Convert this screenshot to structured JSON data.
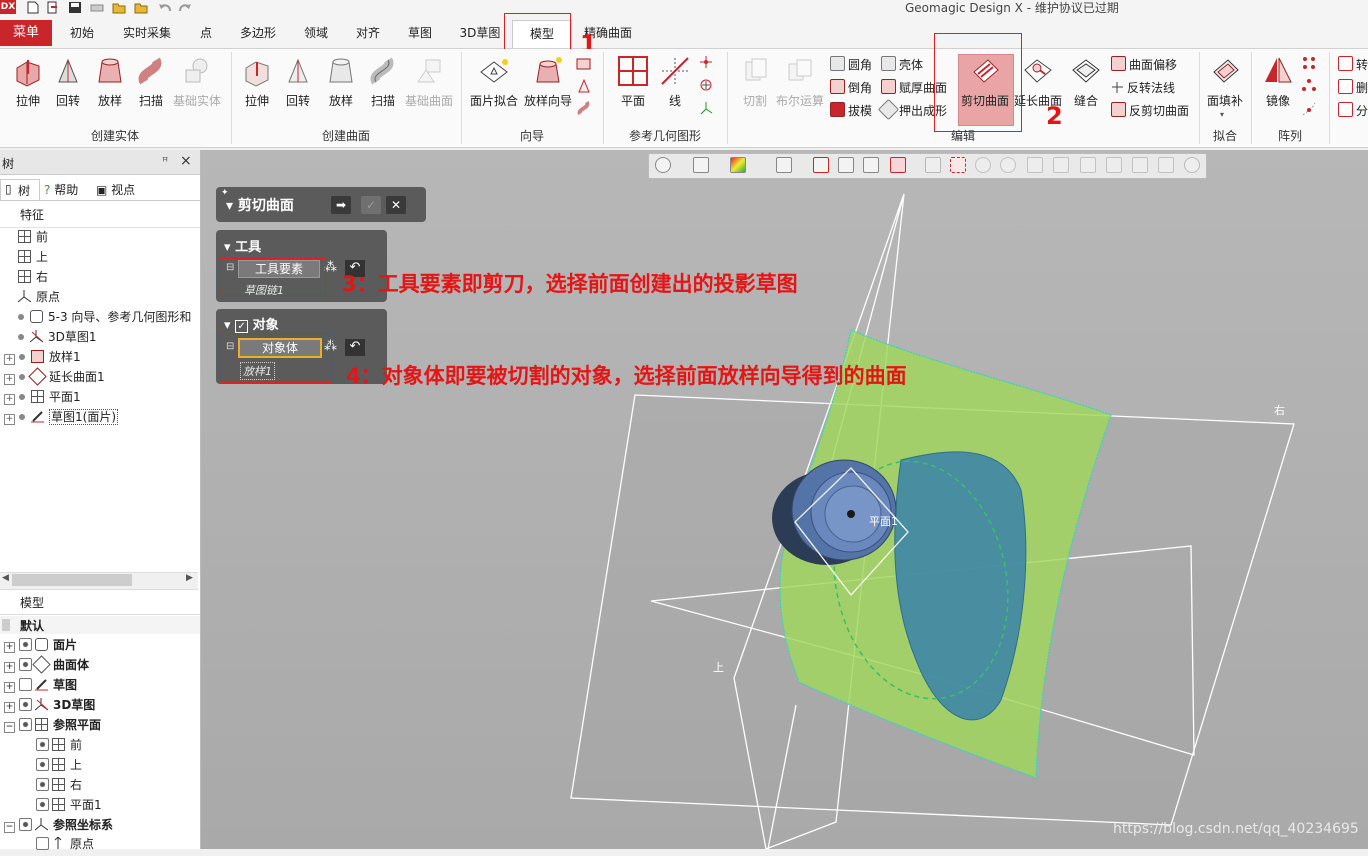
{
  "title_bar": {
    "logo": "DX",
    "window_title": "Geomagic Design X - 维护协议已过期"
  },
  "tabs": {
    "menu": "菜单",
    "items": [
      "初始",
      "实时采集",
      "点",
      "多边形",
      "领域",
      "对齐",
      "草图",
      "3D草图",
      "模型",
      "精确曲面"
    ],
    "active": "模型"
  },
  "ribbon": {
    "create_solid": {
      "label": "创建实体",
      "tools": [
        "拉伸",
        "回转",
        "放样",
        "扫描",
        "基础实体"
      ]
    },
    "create_surface": {
      "label": "创建曲面",
      "tools": [
        "拉伸",
        "回转",
        "放样",
        "扫描",
        "基础曲面"
      ]
    },
    "wizard": {
      "label": "向导",
      "tools": [
        "面片拟合",
        "放样向导"
      ]
    },
    "ref_geometry": {
      "label": "参考几何图形",
      "tools": [
        "平面",
        "线"
      ]
    },
    "edit": {
      "label": "编辑",
      "tools_disabled": [
        "切割",
        "布尔运算"
      ],
      "small_col1": [
        "圆角",
        "倒角",
        "拔模"
      ],
      "small_col2": [
        "壳体",
        "赋厚曲面",
        "押出成形"
      ],
      "trim_surface": "剪切曲面",
      "extend_surface": "延长曲面",
      "stitch": "缝合",
      "small_col3": [
        "曲面偏移",
        "反转法线",
        "反剪切曲面"
      ]
    },
    "fit": {
      "label": "拟合",
      "tools": [
        "面填补"
      ]
    },
    "array": {
      "label": "阵列",
      "tools": [
        "镜像"
      ]
    },
    "right_partial": [
      "转",
      "删",
      "分"
    ]
  },
  "tree_panel": {
    "title": "树",
    "pin": "ꟸ",
    "close": "×",
    "tabs": [
      "树",
      "帮助",
      "视点"
    ],
    "feature_header": "特征",
    "features": [
      "前",
      "上",
      "右",
      "原点",
      "5-3 向导、参考几何图形和",
      "3D草图1",
      "放样1",
      "延长曲面1",
      "平面1",
      "草图1(面片)"
    ],
    "model_header": "模型",
    "default_label": "默认",
    "model_items": [
      "面片",
      "曲面体",
      "草图",
      "3D草图",
      "参照平面"
    ],
    "ref_planes": [
      "前",
      "上",
      "右",
      "平面1"
    ],
    "ref_coord": "参照坐标系",
    "origin": "原点"
  },
  "trim_dialog": {
    "title": "剪切曲面",
    "tools_section": "工具",
    "tool_element_button": "工具要素",
    "tool_element_value": "草图链1",
    "objects_section": "对象",
    "object_body_button": "对象体",
    "object_body_value": "放样1"
  },
  "annotations": {
    "step1": "1",
    "step2": "2",
    "step3": "3：工具要素即剪刀，选择前面创建出的投影草图",
    "step4": "4：对象体即要被切割的对象，选择前面放样向导得到的曲面"
  },
  "viewport_labels": {
    "plane1": "平面1",
    "right": "右",
    "top": "上"
  },
  "watermark": "https://blog.csdn.net/qq_40234695",
  "colors": {
    "accent": "#c8262b",
    "annotation": "#e51515",
    "surface_green": "#9ccf5a",
    "surface_blue": "#3f86a6"
  }
}
